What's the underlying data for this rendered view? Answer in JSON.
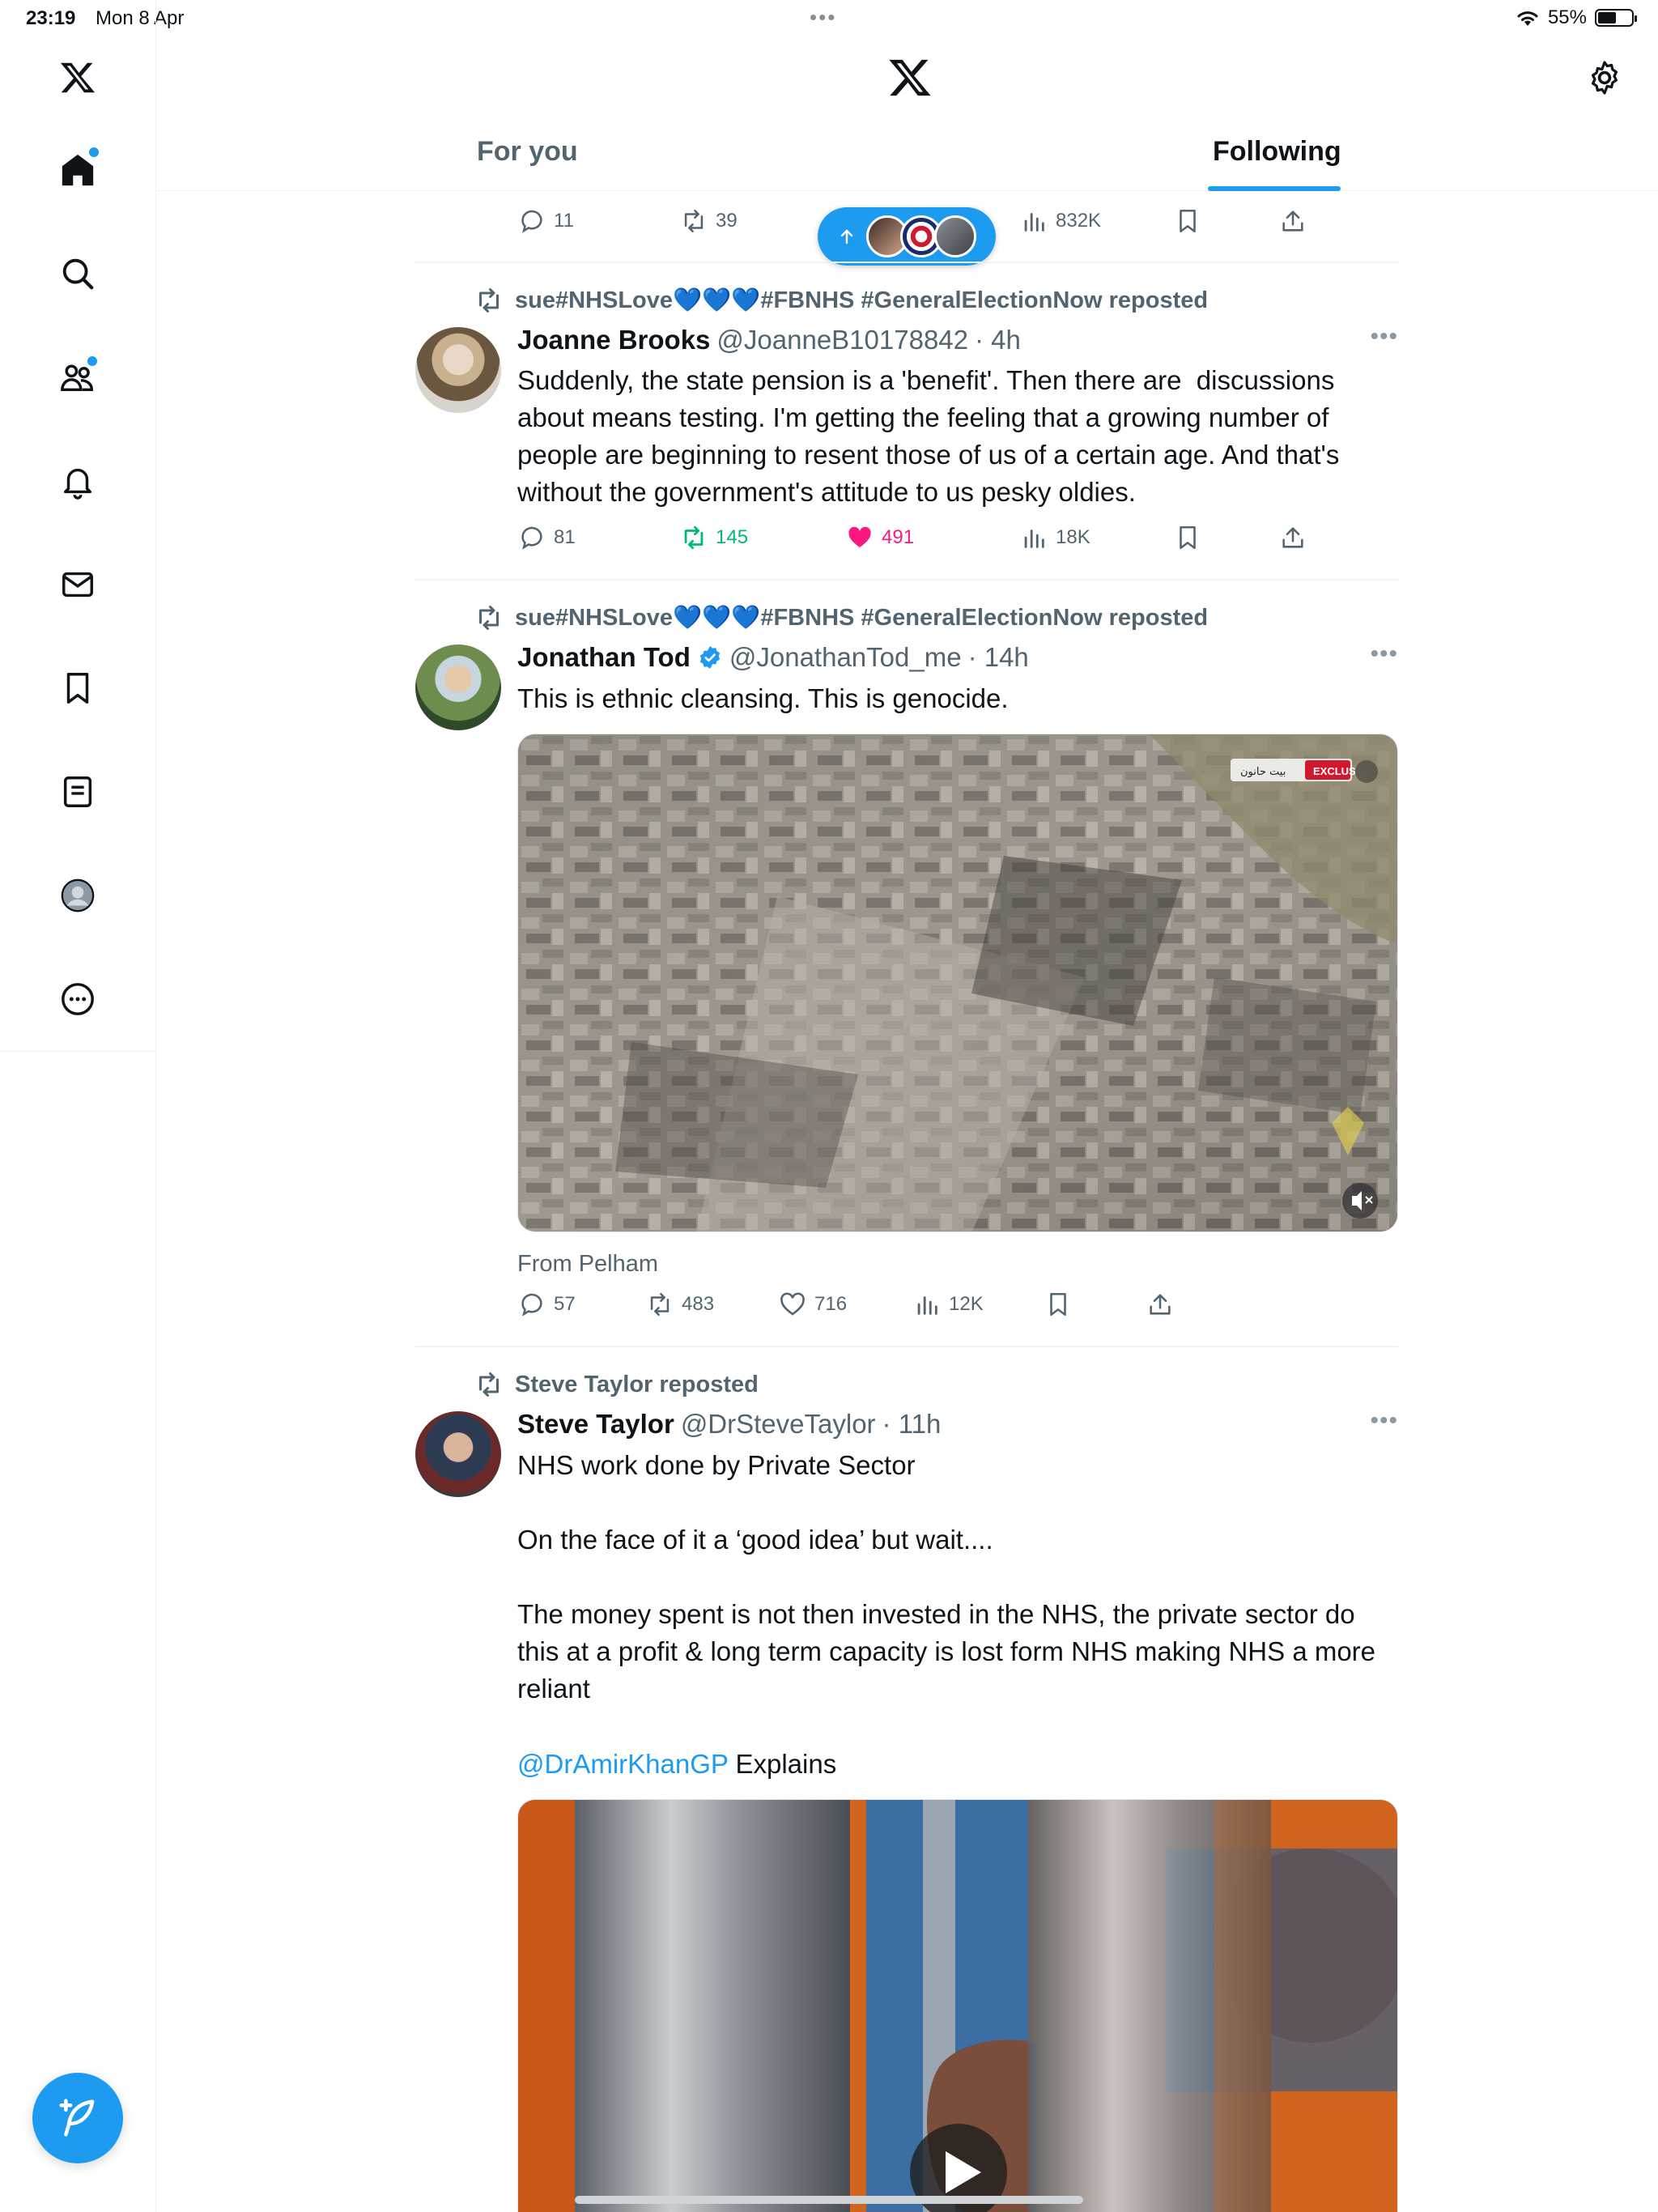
{
  "status_bar": {
    "time": "23:19",
    "date": "Mon 8 Apr",
    "dots": "•••",
    "battery": "55%",
    "battery_level_percent": 55
  },
  "header": {
    "tabs": [
      "For you",
      "Following"
    ],
    "active_tab": "Following"
  },
  "colors": {
    "accent": "#1d9bf0",
    "like": "#f91880",
    "repost": "#00ba7c",
    "secondary_text": "#536471"
  },
  "sidebar": {
    "items": [
      "x-logo-icon",
      "home-icon",
      "search-icon",
      "communities-icon",
      "notifications-icon",
      "messages-icon",
      "bookmarks-icon",
      "lists-icon",
      "profile-icon",
      "more-icon"
    ]
  },
  "top_actions": {
    "replies": "11",
    "reposts": "39",
    "views": "832K"
  },
  "tweets": [
    {
      "reposted_by": "sue#NHSLove💙💙💙#FBNHS #GeneralElectionNow reposted",
      "name": "Joanne Brooks",
      "handle": "@JoanneB10178842",
      "time": "· 4h",
      "text": "Suddenly, the state pension is a 'benefit'. Then there are  discussions about means testing. I'm getting the feeling that a growing number of people are beginning to resent those of us of a certain age. And that's without the government's attitude to us pesky oldies.",
      "replies": "81",
      "reposts": "145",
      "likes": "491",
      "views": "18K"
    },
    {
      "reposted_by": "sue#NHSLove💙💙💙#FBNHS #GeneralElectionNow reposted",
      "name": "Jonathan Tod",
      "handle": "@JonathanTod_me",
      "time": "· 14h",
      "text": "This is ethnic cleansing. This is genocide.",
      "from": "From Pelham",
      "media_badge_1": "EXCLUS",
      "media_badge_2": "بيت حانون",
      "replies": "57",
      "reposts": "483",
      "likes": "716",
      "views": "12K"
    },
    {
      "reposted_by": "Steve Taylor reposted",
      "name": "Steve Taylor",
      "handle": "@DrSteveTaylor",
      "time": "· 11h",
      "text_1": "NHS work done by Private Sector",
      "text_2": "On the face of it a ‘good idea’ but wait....",
      "text_3": "The money spent is not then invested in the NHS, the private sector do this at a profit & long term capacity is lost form NHS making NHS a more reliant",
      "mention": "@DrAmirKhanGP",
      "mention_suffix": " Explains"
    }
  ]
}
